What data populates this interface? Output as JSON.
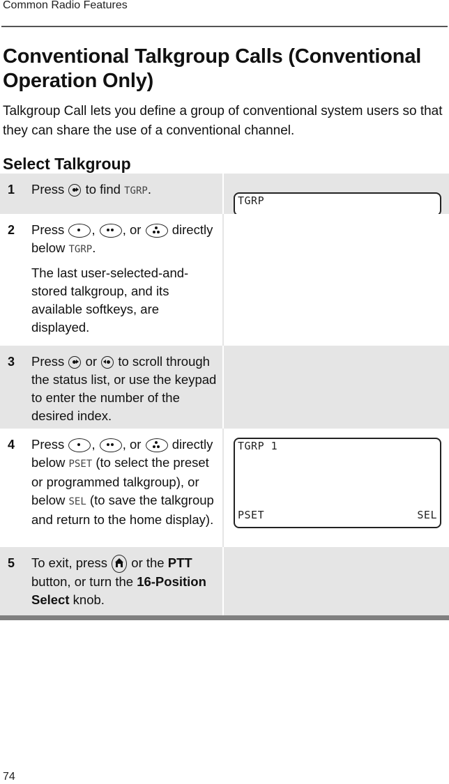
{
  "header": {
    "running_head": "Common Radio Features"
  },
  "title": "Conventional Talkgroup Calls (Conventional Operation Only)",
  "intro": "Talkgroup Call lets you define a group of conventional system users so that they can share the use of a conventional channel.",
  "section_title": "Select Talkgroup",
  "steps": [
    {
      "number": "1",
      "text_parts": [
        "Press",
        "to find",
        "TGRP",
        "."
      ],
      "display": {
        "line1": "TGRP"
      }
    },
    {
      "number": "2",
      "text_parts": [
        "Press",
        ",",
        ", or",
        "directly below",
        "TGRP",
        "."
      ],
      "note": "The last user-selected-and-stored talkgroup, and its available softkeys, are displayed."
    },
    {
      "number": "3",
      "text_parts": [
        "Press",
        "or",
        "to scroll through the status list, or use the keypad to enter the number of the desired index."
      ]
    },
    {
      "number": "4",
      "text_parts": [
        "Press",
        ",",
        ", or",
        "directly below",
        "PSET",
        "(to select the preset or programmed talkgroup), or below",
        "SEL",
        "(to save the talkgroup and return to the home display)."
      ],
      "display": {
        "line1": "TGRP 1",
        "softkey_left": "PSET",
        "softkey_right": "SEL"
      }
    },
    {
      "number": "5",
      "text_parts": [
        "To exit, press",
        "or the",
        "PTT",
        "button, or turn the",
        "16-Position Select",
        "knob."
      ]
    }
  ],
  "icons": {
    "right_nav": "right-navigation-button-icon",
    "left_nav": "left-navigation-button-icon",
    "softkey_1": "one-dot-menu-button-icon",
    "softkey_2": "two-dot-menu-button-icon",
    "softkey_3": "three-dot-menu-button-icon",
    "home": "home-button-icon"
  },
  "colors": {
    "shaded_row": "#e5e5e5",
    "bottom_rule": "#808080",
    "header_rule": "#555555"
  },
  "footer": {
    "page_number": "74"
  }
}
